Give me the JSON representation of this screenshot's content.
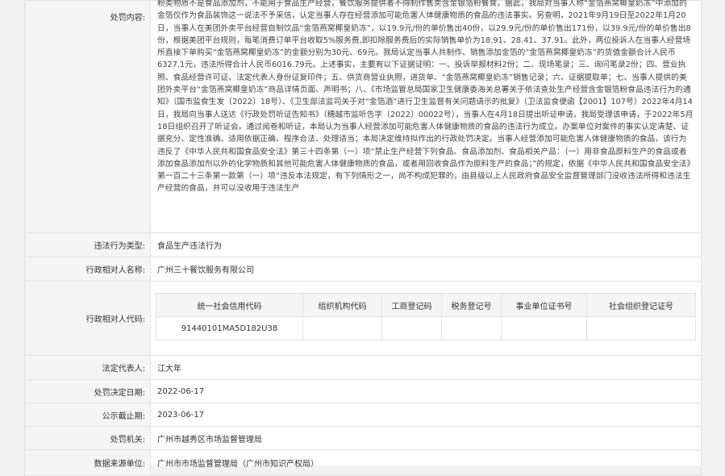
{
  "punishment": {
    "label": "处罚内容:",
    "text": "粉类物质不是食品添加剂，不能用于食品生产经营，餐饮服务提供者不得制作售卖含金银箔粉餐食。据此，我局对当事人称“金箔燕窝椰皇奶冻”中添加的金箔仅作为食品装饰这一说法不予采信，认定当事人存在经营添加可能危害人体健康物质的食品的违法事实。另查明，2021年9月19日至2022年1月20日，当事人在美团外卖平台经营自制饮品“金箔燕窝椰皇奶冻”，以19.9元/份的单价售出40份，以29.9元/份的单价售出171份，以39.9元/份的单价售出8份，根据美团平台规则，每笔消费订单平台收取5%服务费,即扣除服务费后的实际销售单价为18.91、28.41、37.91。此外，两位投诉人在当事人经营场所直接下单购买“金箔燕窝椰皇奶冻”的金额分别为30元、69元。我局认定当事人共制作、销售添加金箔的“金箔燕窝椰皇奶冻”的货值金额合计人民币6327.1元，违法所得合计人民币6016.79元。上述事实，主要有以下证据证明：一、投诉举报材料2份；二、现场笔录；三、询问笔录2份；四、营业执照、食品经营许可证、法定代表人身份证复印件；五、供货商营业执照，进货单、“金箔燕窝椰皇奶冻”销售记录；六、证据提取单；七、当事人提供的美团外卖平台“金箔燕窝椰皇奶冻”商品详情页面、声明书；八、《市场监管总局国家卫生健康委海关总署关于依法查处生产经营含金银箔粉食品违法行为的通知》（国市监食生发〔2022〕18号）、《卫生部法监司关于对“金箔酒”进行卫生监督有关问题请示的批复》（卫法监食便函【2001】107号）2022年4月14日，我局向当事人送达《行政处罚听证告知书》（穗越市监听告字〔2022〕00022号），当事人在4月18日提出听证申请，我局受理该申请，于2022年5月18日组织召开了听证会。通过阅卷和听证，本局认为当事人经营添加可能危害人体健康物质的食品的违法行为成立。办案单位对案件的事实认定清楚、证据充分、定性准确、适用依据正确、程序合法、处理适当；本局决定维持拟作出的行政处罚决定。当事人经营添加可能危害人体健康物质的食品，该行为违反了《中华人民共和国食品安全法》第三十四条第（一）项“禁止生产经营下列食品、食品添加剂、食品相关产品：（一）用非食品原料生产的食品或者添加食品添加剂以外的化学物质和其他可能危害人体健康物质的食品，或者用回收食品作为原料生产的食品；”的规定，依据《中华人民共和国食品安全法》第一百二十三条第一款第（一）项“违反本法规定，有下列情形之一，尚不构成犯罪的，由县级以上人民政府食品安全监督管理部门没收违法所得和违法生产经营的食品，并可以没收用于违法生产"
  },
  "violation_type": {
    "label": "违法行为类型:",
    "value": "食品生产违法行为"
  },
  "counterpart_name": {
    "label": "行政相对人名称:",
    "value": "广州三十餐饮服务有限公司"
  },
  "counterpart_codes": {
    "label": "行政相对人代码:",
    "headers": [
      "统一社会信用代码",
      "组织机构代码",
      "工商登记码",
      "税务登记号",
      "事业单位证书号",
      "社会组织登记证号"
    ],
    "values": [
      "91440101MA5D182U38",
      "",
      "",
      "",
      "",
      ""
    ]
  },
  "legal_rep": {
    "label": "法定代表人:",
    "value": "江大年"
  },
  "decision_date": {
    "label": "处罚决定日期:",
    "value": "2022-06-17"
  },
  "publish_end": {
    "label": "公示截止期:",
    "value": "2023-06-17"
  },
  "authority": {
    "label": "处罚机关:",
    "value": "广州市越秀区市场监督管理局"
  },
  "data_source": {
    "label": "数据来源单位:",
    "value": "广州市市场监督管理局（广州市知识产权局）"
  }
}
